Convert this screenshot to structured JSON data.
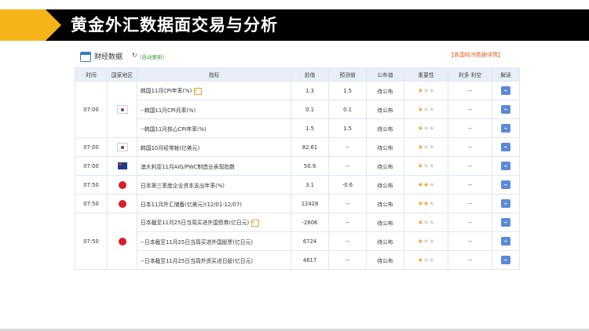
{
  "title": "黄金外汇数据面交易与分析",
  "panel": {
    "heading": "财经数据",
    "refresh_icon": "refresh-icon",
    "auto_label": "(自动更新)",
    "detail_link": "【各国经济数据详情】"
  },
  "columns": [
    "时间",
    "国家地区",
    "指标",
    "前值",
    "预测值",
    "公布值",
    "重要性",
    "利多  利空",
    "解读"
  ],
  "groups": [
    {
      "time": "07:00",
      "flag": "kr",
      "rows": [
        {
          "indicator": "韩国11月CPI年率(%)",
          "badge": true,
          "prev": "1.3",
          "forecast": "1.5",
          "actual": "待公布",
          "stars": 1,
          "impact": "--"
        },
        {
          "indicator": "--韩国11月CPI月率(%)",
          "badge": false,
          "prev": "0.1",
          "forecast": "0.1",
          "actual": "待公布",
          "stars": 1,
          "impact": "--"
        },
        {
          "indicator": "--韩国11月核心CPI年率(%)",
          "badge": false,
          "prev": "1.5",
          "forecast": "1.5",
          "actual": "待公布",
          "stars": 1,
          "impact": "--"
        }
      ]
    },
    {
      "time": "07:00",
      "flag": "kr",
      "rows": [
        {
          "indicator": "韩国10月经常帐(亿美元)",
          "badge": false,
          "prev": "82.61",
          "forecast": "--",
          "actual": "待公布",
          "stars": 1,
          "impact": "--"
        }
      ]
    },
    {
      "time": "07:00",
      "flag": "au",
      "rows": [
        {
          "indicator": "澳大利亚11月AIG/PWC制造业表现指数",
          "badge": false,
          "prev": "50.9",
          "forecast": "--",
          "actual": "待公布",
          "stars": 1,
          "impact": "--"
        }
      ]
    },
    {
      "time": "07:50",
      "flag": "jp",
      "rows": [
        {
          "indicator": "日本第三季度企业资本支出年率(%)",
          "badge": false,
          "prev": "3.1",
          "forecast": "-0.6",
          "actual": "待公布",
          "stars": 2,
          "impact": "--"
        }
      ]
    },
    {
      "time": "07:50",
      "flag": "jp",
      "rows": [
        {
          "indicator": "日本11月外汇储备(亿美元)(12/01-12/07)",
          "badge": false,
          "prev": "12428",
          "forecast": "--",
          "actual": "待公布",
          "stars": 2,
          "impact": "--"
        }
      ]
    },
    {
      "time": "07:50",
      "flag": "jp",
      "rows": [
        {
          "indicator": "日本截至11月25日当周买进外国债券(亿日元)",
          "badge": true,
          "prev": "-2606",
          "forecast": "--",
          "actual": "待公布",
          "stars": 1,
          "impact": "--"
        },
        {
          "indicator": "--日本截至11月25日当周买进外国股票(亿日元)",
          "badge": false,
          "prev": "6724",
          "forecast": "--",
          "actual": "待公布",
          "stars": 1,
          "impact": "--"
        },
        {
          "indicator": "--日本截至11月25日当周外资买进日股(亿日元)",
          "badge": false,
          "prev": "4617",
          "forecast": "--",
          "actual": "待公布",
          "stars": 1,
          "impact": "--"
        }
      ]
    }
  ],
  "colors": {
    "accent": "#f5b418",
    "title_bg": "#000000",
    "header_bg": "#e8eff8",
    "star": "#f0a020",
    "read_icon": "#5a8ad8"
  }
}
